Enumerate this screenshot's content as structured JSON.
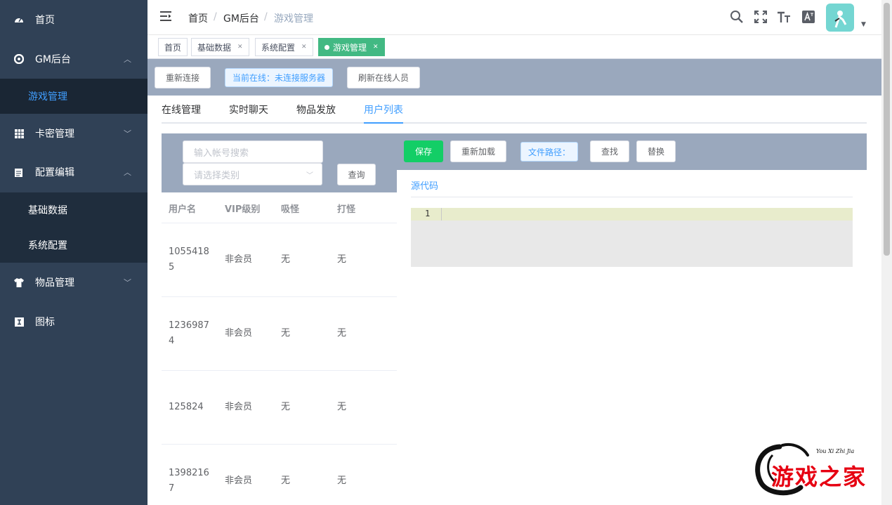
{
  "sidebar": {
    "items": [
      {
        "label": "首页",
        "icon": "dashboard-icon"
      },
      {
        "label": "GM后台",
        "icon": "lifebuoy-icon",
        "expanded": true
      },
      {
        "label": "卡密管理",
        "icon": "grid-icon",
        "expanded": false
      },
      {
        "label": "配置编辑",
        "icon": "edit-doc-icon",
        "expanded": true
      },
      {
        "label": "物品管理",
        "icon": "shirt-icon",
        "expanded": false
      },
      {
        "label": "图标",
        "icon": "info-icon"
      }
    ],
    "gm_children": [
      "游戏管理"
    ],
    "config_children": [
      "基础数据",
      "系统配置"
    ]
  },
  "header": {
    "breadcrumb": [
      "首页",
      "GM后台",
      "游戏管理"
    ],
    "breadcrumb_separator": "/",
    "icons": [
      "search-icon",
      "fullscreen-icon",
      "font-size-icon",
      "translate-icon"
    ]
  },
  "tags": [
    {
      "label": "首页",
      "closable": false
    },
    {
      "label": "基础数据",
      "closable": true
    },
    {
      "label": "系统配置",
      "closable": true
    },
    {
      "label": "游戏管理",
      "closable": true,
      "active": true
    }
  ],
  "toolbar": {
    "reconnect": "重新连接",
    "online_status": "当前在线：未连接服务器",
    "refresh_online": "刷新在线人员"
  },
  "tabs": {
    "items": [
      "在线管理",
      "实时聊天",
      "物品发放",
      "用户列表"
    ],
    "active_index": 3
  },
  "search": {
    "account_placeholder": "输入帐号搜索",
    "category_placeholder": "请选择类别",
    "query_button": "查询"
  },
  "table": {
    "headers": [
      "用户名",
      "VIP级别",
      "吸怪",
      "打怪"
    ],
    "rows": [
      [
        "10554185",
        "非会员",
        "无",
        "无"
      ],
      [
        "12369874",
        "非会员",
        "无",
        "无"
      ],
      [
        "125824",
        "非会员",
        "无",
        "无"
      ],
      [
        "13982167",
        "非会员",
        "无",
        "无"
      ]
    ]
  },
  "editor": {
    "save": "保存",
    "reload": "重新加载",
    "file_path": "文件路径：",
    "find": "查找",
    "replace": "替换",
    "source_title": "源代码",
    "line_number": "1"
  },
  "watermark": {
    "text": "游戏之家",
    "pinyin": "You Xi Zhi Jia"
  },
  "colors": {
    "sidebar_bg": "#304156",
    "submenu_bg": "#1f2d3d",
    "accent": "#409eff",
    "tag_active": "#42b983",
    "success": "#13ce66",
    "panel_bg": "#9aa8bd"
  }
}
